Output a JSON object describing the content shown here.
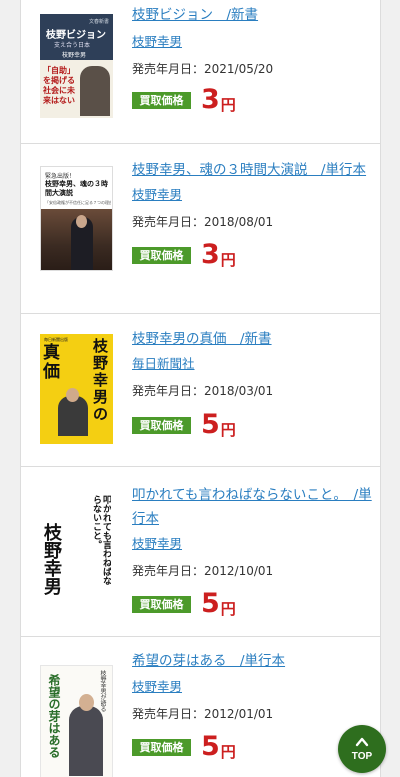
{
  "items": [
    {
      "title": "枝野ビジョン　/新書",
      "author": "枝野幸男",
      "date": "発売年月日：2021/05/20",
      "badge": "買取価格",
      "price": "3",
      "unit": "円",
      "cover": {
        "top": "文春新書",
        "name": "枝野ビジョン",
        "sub": "支え合う日本",
        "author": "枝野幸男",
        "slogan": "「自助」を掲げる社会に未来はない"
      }
    },
    {
      "title": "枝野幸男、魂の３時間大演説　/単行本",
      "author": "枝野幸男",
      "date": "発売年月日：2018/08/01",
      "badge": "買取価格",
      "price": "3",
      "unit": "円",
      "cover": {
        "top": "緊急出版！",
        "name": "枝野幸男、魂の３時間大演説",
        "sub": "「安倍政権が不信任に足る７つの理由」"
      }
    },
    {
      "title": "枝野幸男の真価　/新書",
      "author": "毎日新聞社",
      "date": "発売年月日：2018/03/01",
      "badge": "買取価格",
      "price": "5",
      "unit": "円",
      "cover": {
        "top": "毎日新聞出版",
        "left": "真価",
        "right": "枝野幸男の"
      }
    },
    {
      "title": "叩かれても言わねばならないこと。　/単行本",
      "author": "枝野幸男",
      "date": "発売年月日：2012/10/01",
      "badge": "買取価格",
      "price": "5",
      "unit": "円",
      "cover": {
        "title": "叩かれても言わねばならないこと。",
        "author": "枝野幸男"
      }
    },
    {
      "title": "希望の芽はある　/単行本",
      "author": "枝野幸男",
      "date": "発売年月日：2012/01/01",
      "badge": "買取価格",
      "price": "5",
      "unit": "円",
      "cover": {
        "title": "希望の芽はある",
        "sub": "枝野幸男が語る"
      }
    }
  ],
  "top_button": {
    "label": "TOP"
  },
  "colors": {
    "link": "#2a7ec0",
    "badge": "#4c9a2a",
    "price": "#cc1f1f",
    "top_button": "#2e6e1e"
  }
}
